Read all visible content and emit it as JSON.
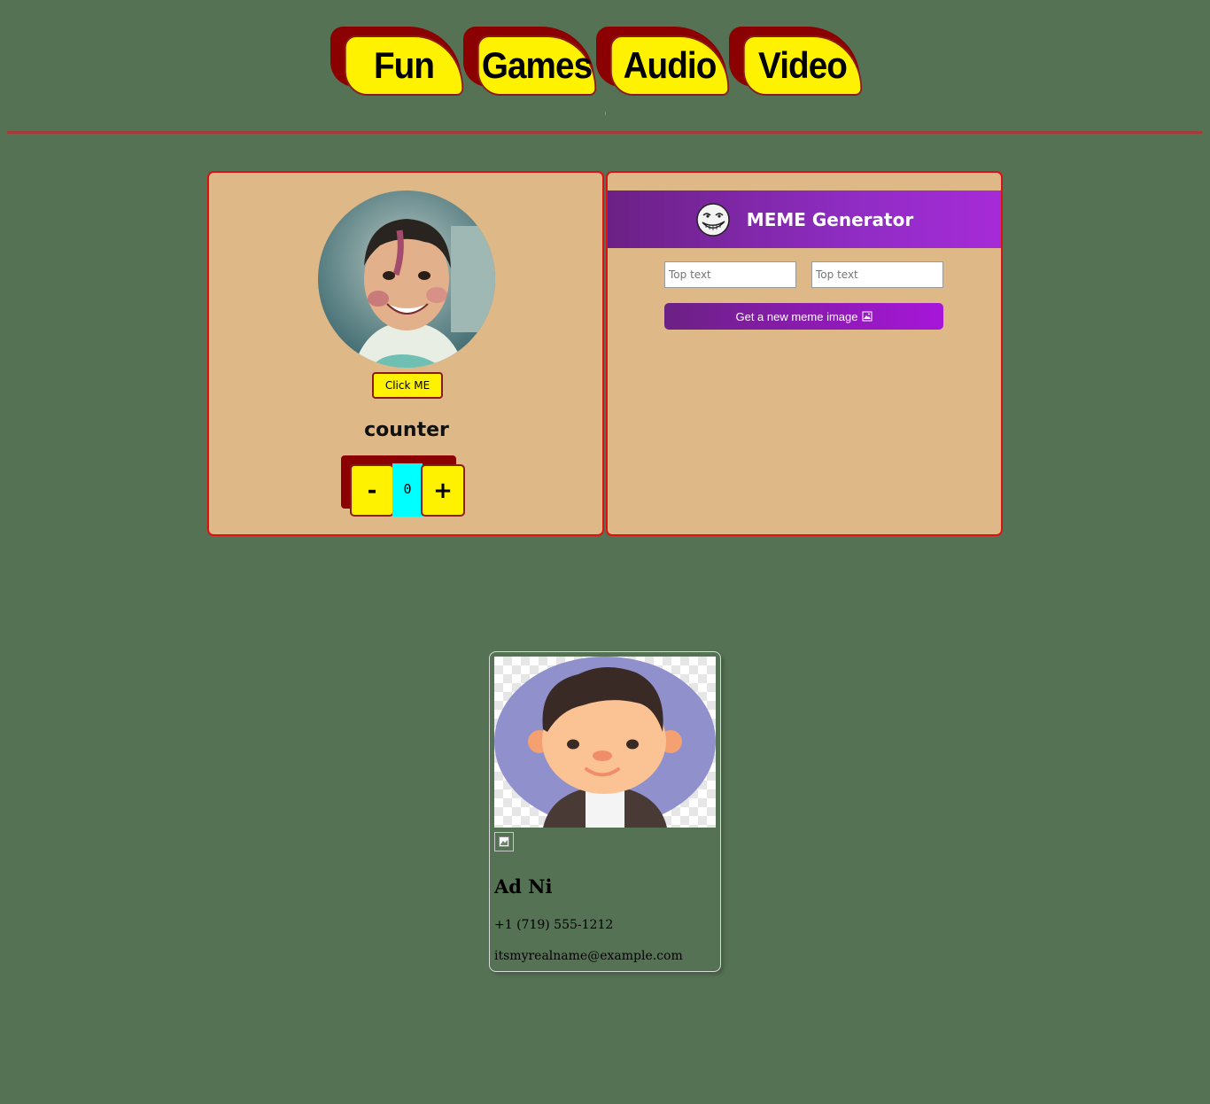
{
  "nav": {
    "tabs": [
      {
        "label": "Fun"
      },
      {
        "label": "Games"
      },
      {
        "label": "Audio"
      },
      {
        "label": "Video"
      }
    ]
  },
  "profile_panel": {
    "click_button_label": "Click ME",
    "counter_title": "counter",
    "counter_value": "0",
    "decrement_label": "-",
    "increment_label": "+"
  },
  "meme": {
    "title": "MEME Generator",
    "icon": "troll-face-icon",
    "top_text_placeholder": "Top text",
    "bottom_text_placeholder": "Top text",
    "button_label": "Get a new meme image",
    "button_icon": "image-icon"
  },
  "contact_card": {
    "name": "Ad Ni",
    "phone": "+1 (719) 555-1212",
    "email": "itsmyrealname@example.com"
  },
  "colors": {
    "page_bg": "#567254",
    "panel_bg": "#deb887",
    "panel_border": "#dd1111",
    "accent_yellow": "#fff200",
    "accent_dark_red": "#8b0000",
    "counter_cyan": "#00ffff",
    "meme_purple": "#8e2cc2"
  }
}
